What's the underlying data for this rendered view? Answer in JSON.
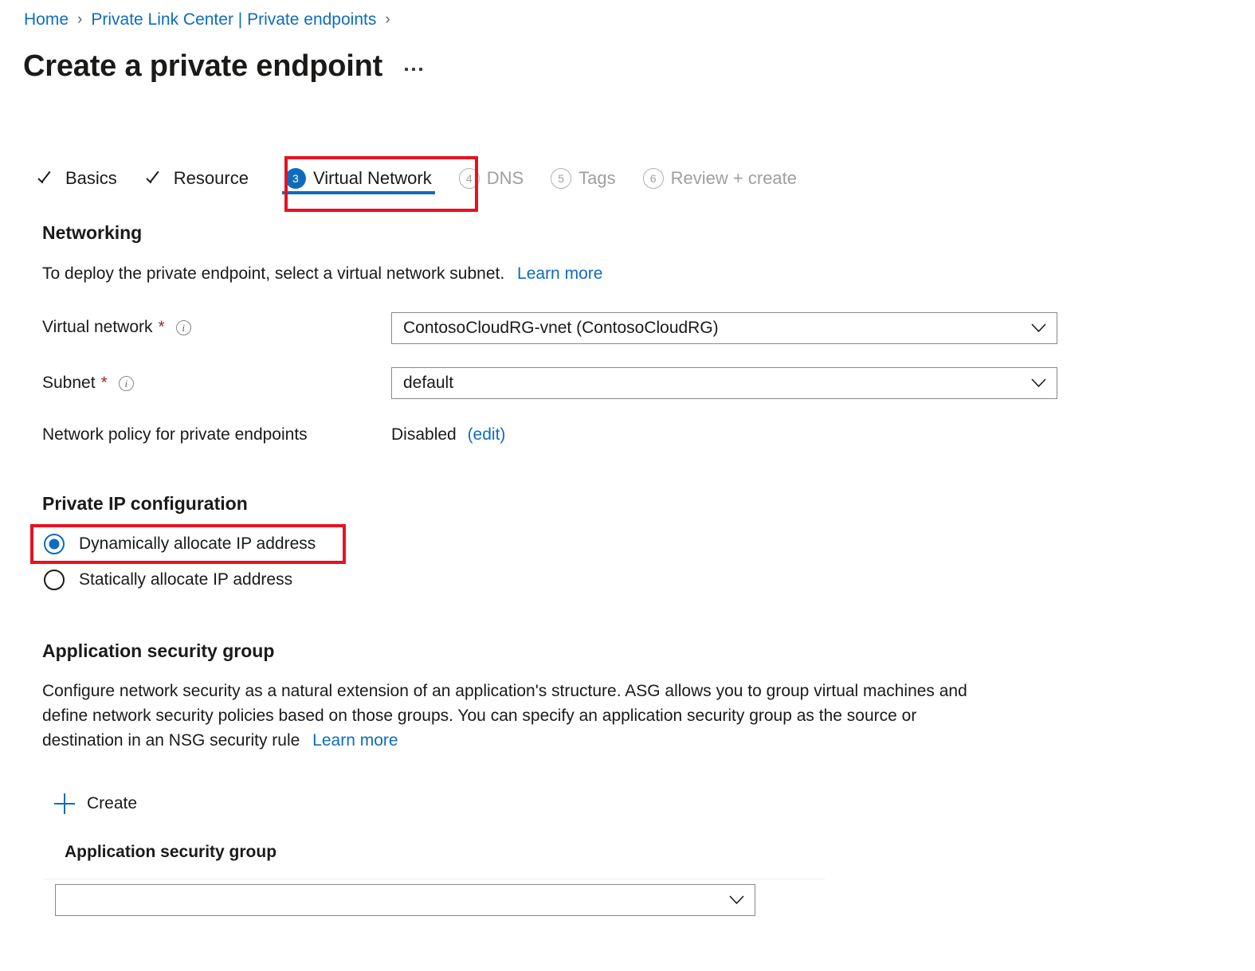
{
  "breadcrumb": {
    "items": [
      {
        "label": "Home",
        "icon": "chevron-right-icon"
      },
      {
        "label": "Private Link Center | Private endpoints",
        "icon": "chevron-right-icon"
      }
    ],
    "separator": "›"
  },
  "header": {
    "title": "Create a private endpoint",
    "more_actions": "more-actions-icon"
  },
  "wizard": {
    "tabs": [
      {
        "id": "basics",
        "label": "Basics",
        "state": "done",
        "marker": "check"
      },
      {
        "id": "resource",
        "label": "Resource",
        "state": "done",
        "marker": "check"
      },
      {
        "id": "virtualnetwork",
        "label": "Virtual Network",
        "state": "active",
        "marker": "3"
      },
      {
        "id": "dns",
        "label": "DNS",
        "state": "muted",
        "marker": "4"
      },
      {
        "id": "tags",
        "label": "Tags",
        "state": "muted",
        "marker": "5"
      },
      {
        "id": "review",
        "label": "Review + create",
        "state": "muted",
        "marker": "6"
      }
    ]
  },
  "networking": {
    "heading": "Networking",
    "description": "To deploy the private endpoint, select a virtual network subnet.",
    "learn_more": "Learn more",
    "virtual_network": {
      "label": "Virtual network",
      "required_marker": "*",
      "info": "info-icon",
      "value": "ContosoCloudRG-vnet (ContosoCloudRG)"
    },
    "subnet": {
      "label": "Subnet",
      "required_marker": "*",
      "info": "info-icon",
      "value": "default"
    },
    "network_policy": {
      "label": "Network policy for private endpoints",
      "value": "Disabled",
      "edit_link": "(edit)"
    }
  },
  "private_ip": {
    "heading": "Private IP configuration",
    "options": [
      {
        "label": "Dynamically allocate IP address",
        "selected": true
      },
      {
        "label": "Statically allocate IP address",
        "selected": false
      }
    ]
  },
  "asg": {
    "heading": "Application security group",
    "description_line1": "Configure network security as a natural extension of an application's structure. ASG allows you to group virtual machines and",
    "description_line2": "define network security policies based on those groups. You can specify an application security group as the source or",
    "description_line3": "destination in an NSG security rule",
    "learn_more": "Learn more",
    "create_label": "Create",
    "create_icon": "plus-icon",
    "field_label": "Application security group",
    "field_value": "",
    "field_placeholder": ""
  },
  "colors": {
    "accent_blue": "#0f6cbd",
    "highlight_red": "#e81123",
    "required_red": "#a4262c",
    "muted_grey": "#a19f9d",
    "text_dark": "#1b1a19",
    "border_grey": "#8a8886"
  }
}
